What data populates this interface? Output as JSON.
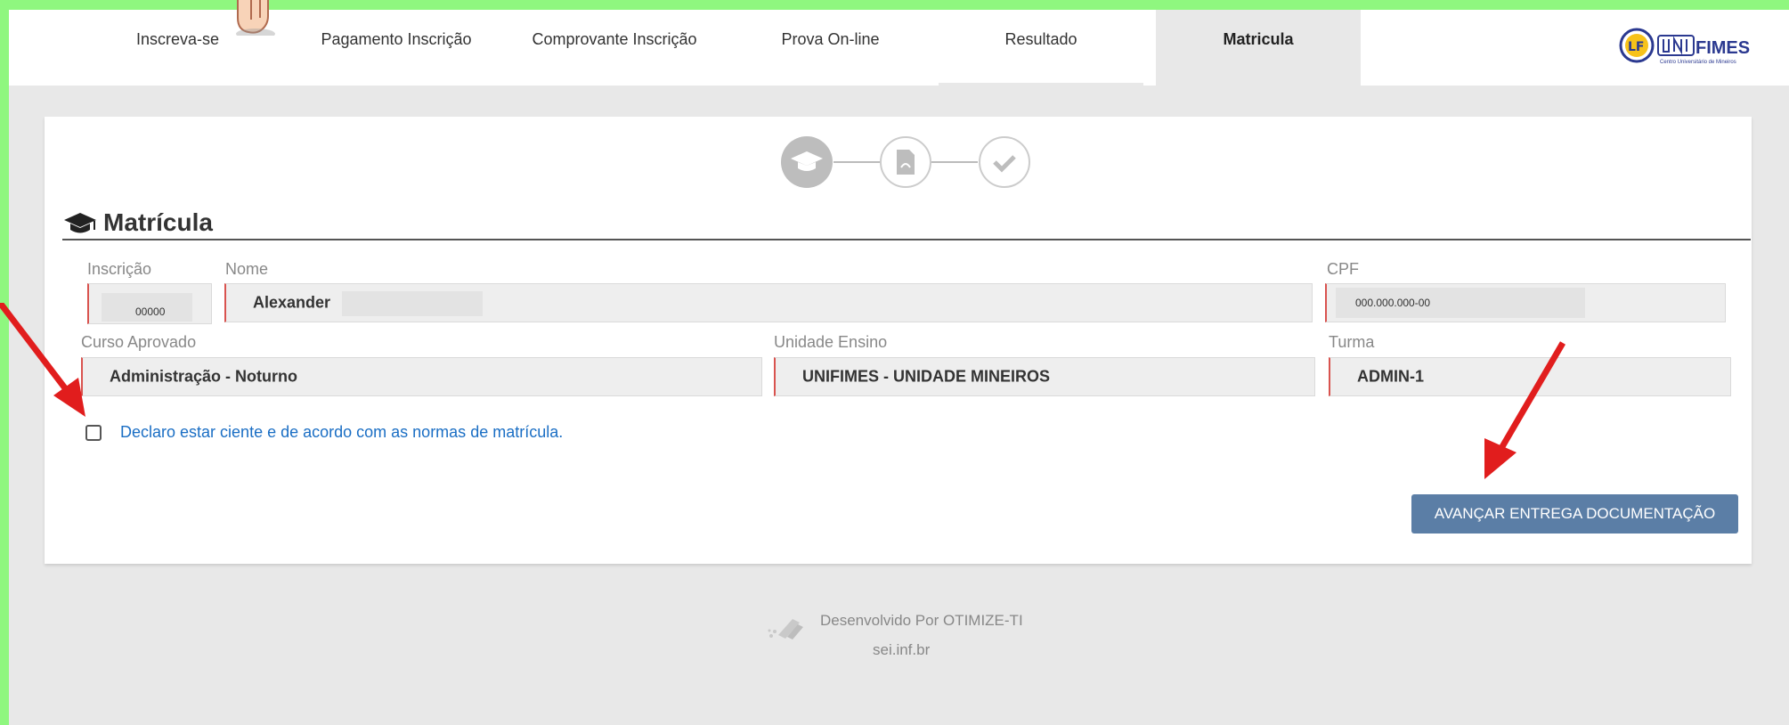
{
  "nav": {
    "items": [
      {
        "label": "Inscreva-se"
      },
      {
        "label": "Pagamento Inscrição"
      },
      {
        "label": "Comprovante Inscrição"
      },
      {
        "label": "Prova On-line"
      },
      {
        "label": "Resultado"
      },
      {
        "label": "Matricula"
      }
    ],
    "active_index": 5,
    "logo_text": "FIMES",
    "logo_subtext": "Centro Universitário de Mineiros"
  },
  "steps": {
    "icons": [
      "graduation-cap-icon",
      "pdf-document-icon",
      "check-icon"
    ],
    "current": 1
  },
  "section": {
    "title": "Matrícula"
  },
  "form": {
    "inscricao_label": "Inscrição",
    "inscricao_value": "00000",
    "nome_label": "Nome",
    "nome_value": "Alexander",
    "cpf_label": "CPF",
    "cpf_value": "000.000.000-00",
    "curso_label": "Curso Aprovado",
    "curso_value": "Administração - Noturno",
    "unidade_label": "Unidade Ensino",
    "unidade_value": "UNIFIMES - UNIDADE MINEIROS",
    "turma_label": "Turma",
    "turma_value": "ADMIN-1"
  },
  "agreement": {
    "label": "Declaro estar ciente e de acordo com as normas de matrícula.",
    "checked": false
  },
  "actions": {
    "advance_label": "AVANÇAR ENTREGA DOCUMENTAÇÃO"
  },
  "footer": {
    "developed_by": "Desenvolvido Por OTIMIZE-TI",
    "site": "sei.inf.br"
  },
  "colors": {
    "accent_green": "#8ff77f",
    "button": "#5b7ea6",
    "link_blue": "#1a6ec4",
    "required_red": "#d9534f",
    "annotation_arrow": "#e11d1d"
  }
}
